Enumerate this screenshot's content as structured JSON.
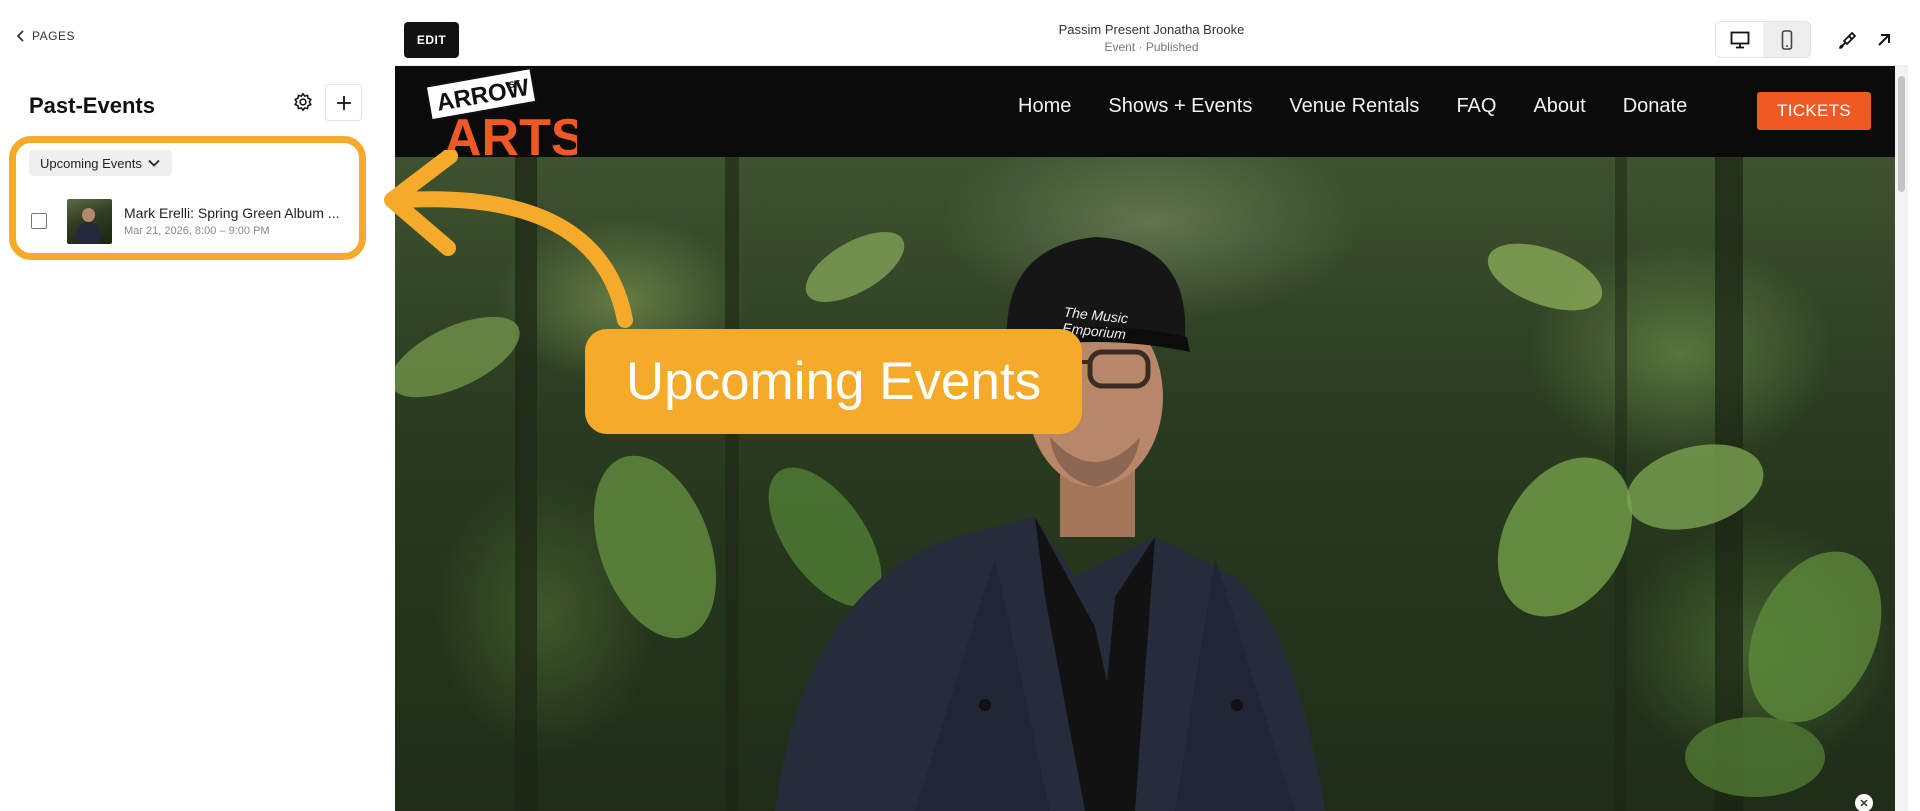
{
  "sidebar": {
    "back_label": "PAGES",
    "title": "Past-Events",
    "filter_label": "Upcoming Events",
    "events": [
      {
        "title": "Mark Erelli: Spring Green Album ...",
        "date": "Mar 21, 2026, 8:00 – 9:00 PM"
      }
    ]
  },
  "editor": {
    "edit_label": "EDIT",
    "page_name": "Passim Present Jonatha Brooke",
    "page_status": "Event · Published"
  },
  "site": {
    "logo_top": "ARROW",
    "logo_st": "ST",
    "logo_bottom": "ARTS",
    "nav": [
      "Home",
      "Shows + Events",
      "Venue Rentals",
      "FAQ",
      "About",
      "Donate"
    ],
    "tickets_label": "TICKETS",
    "cap_text": "The Music Emporium"
  },
  "annotation": {
    "callout_text": "Upcoming Events"
  },
  "colors": {
    "highlight": "#f6aa2a",
    "tickets": "#ef5a24",
    "logo_orange": "#ef5a24"
  }
}
